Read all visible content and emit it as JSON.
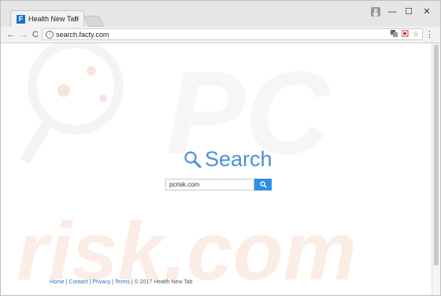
{
  "tab": {
    "title": "Health New Tab",
    "favicon_letter": "F",
    "close_glyph": "×"
  },
  "window_controls": {
    "minimize": "—",
    "maximize": "☐",
    "close": "✕"
  },
  "nav": {
    "back": "←",
    "forward": "→",
    "reload": "C"
  },
  "omnibox": {
    "url": "search.facty.com",
    "info": "i"
  },
  "toolbar_icons": {
    "menu": "⋮",
    "star": "☆"
  },
  "search": {
    "logo_text": "Search",
    "input_value": "pcrisk.com"
  },
  "footer": {
    "home": "Home",
    "contact": "Contact",
    "privacy": "Privacy",
    "terms": "Terms",
    "copyright": "© 2017 Health New Tab",
    "sep": " | "
  },
  "watermark": {
    "text": "risk.com",
    "letters": "PC"
  },
  "colors": {
    "accent": "#2f8ee5",
    "logo": "#4a90d9",
    "watermark": "#f7d8cf"
  }
}
